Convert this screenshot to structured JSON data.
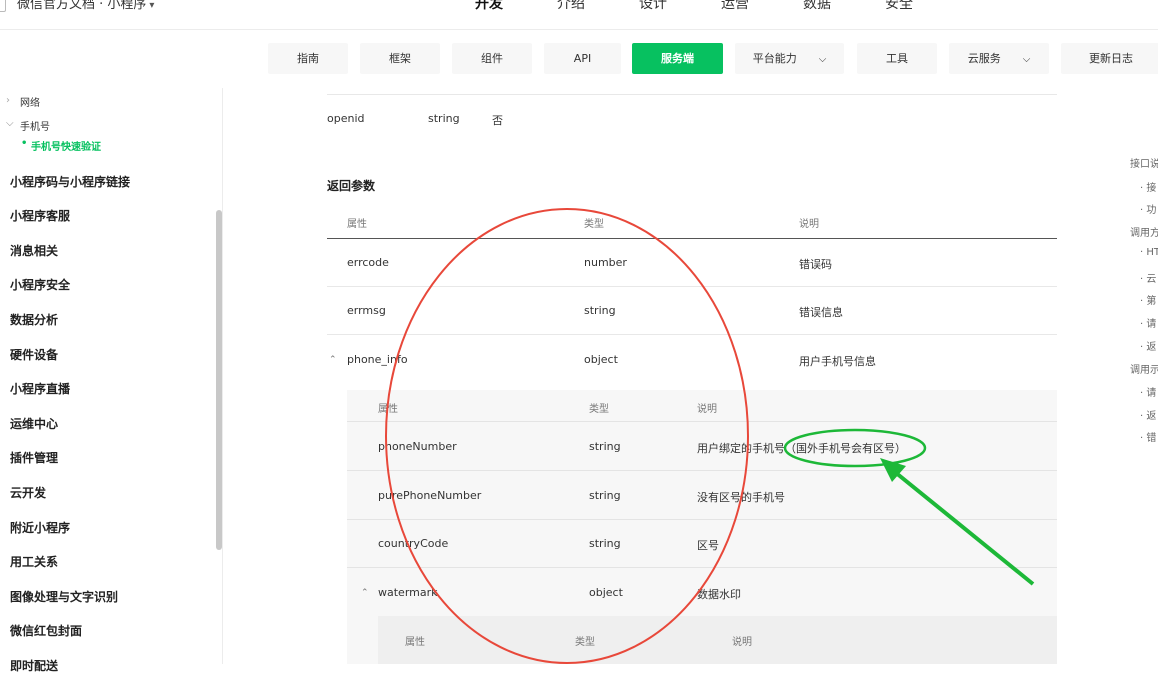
{
  "header": {
    "brand_title": "微信官方文档 · 小程序",
    "nav": [
      "开发",
      "介绍",
      "设计",
      "运营",
      "数据",
      "安全"
    ]
  },
  "subnav": {
    "items": [
      "指南",
      "框架",
      "组件",
      "API",
      "服务端",
      "平台能力",
      "工具",
      "云服务",
      "更新日志"
    ]
  },
  "sidebar": {
    "sub_items": [
      "网络",
      "手机号",
      "手机号快速验证"
    ],
    "items": [
      "小程序码与小程序链接",
      "小程序客服",
      "消息相关",
      "小程序安全",
      "数据分析",
      "硬件设备",
      "小程序直播",
      "运维中心",
      "插件管理",
      "云开发",
      "附近小程序",
      "用工关系",
      "图像处理与文字识别",
      "微信红包封面",
      "即时配送"
    ]
  },
  "request_row": {
    "name": "openid",
    "type": "string",
    "required": "否"
  },
  "return_section": {
    "title": "返回参数",
    "headers": [
      "属性",
      "类型",
      "说明"
    ],
    "rows": [
      {
        "name": "errcode",
        "type": "number",
        "desc": "错误码"
      },
      {
        "name": "errmsg",
        "type": "string",
        "desc": "错误信息"
      },
      {
        "name": "phone_info",
        "type": "object",
        "desc": "用户手机号信息"
      }
    ],
    "phone_info_headers": [
      "属性",
      "类型",
      "说明"
    ],
    "phone_info_rows": [
      {
        "name": "phoneNumber",
        "type": "string",
        "desc": "用户绑定的手机号（国外手机号会有区号）"
      },
      {
        "name": "purePhoneNumber",
        "type": "string",
        "desc": "没有区号的手机号"
      },
      {
        "name": "countryCode",
        "type": "string",
        "desc": "区号"
      },
      {
        "name": "watermark",
        "type": "object",
        "desc": "数据水印"
      }
    ],
    "watermark_headers": [
      "属性",
      "类型",
      "说明"
    ]
  },
  "toc": [
    "接口说",
    "· 接",
    "· 功",
    "调用方",
    "· HT",
    "· 云",
    "· 第",
    "· 请",
    "· 返",
    "调用示",
    "· 请",
    "· 返",
    "· 错"
  ],
  "colors": {
    "accent": "#07c160",
    "annotation_red": "#e8483a",
    "annotation_green": "#1db838"
  }
}
